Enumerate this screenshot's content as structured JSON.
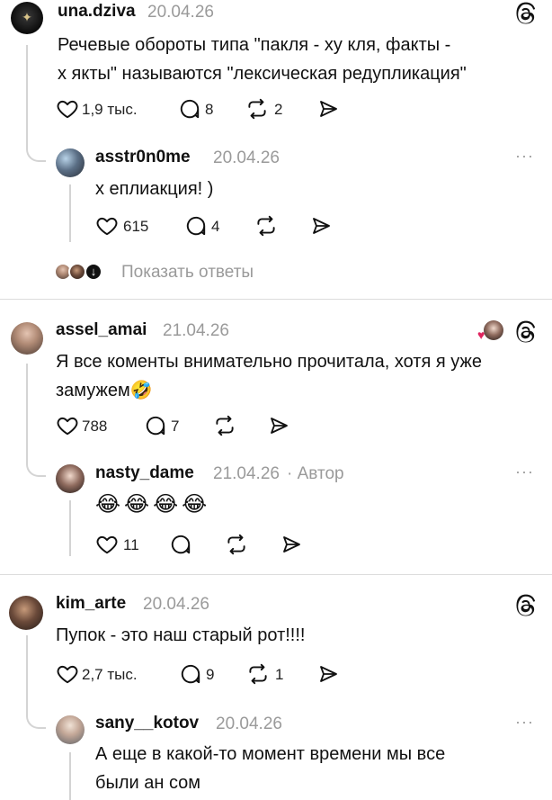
{
  "threads": [
    {
      "username": "una.dziva",
      "date": "20.04.26",
      "text_lines": [
        "Речевые обороты типа \"пакля - ху  кля, факты -",
        "х  якты\" называются \"лексическая редупликация\""
      ],
      "likes": "1,9 тыс.",
      "comments": "8",
      "reposts": "2",
      "replies": [
        {
          "username": "asstr0n0me",
          "date": "20.04.26",
          "text": "х  еплиакция! )",
          "likes": "615",
          "comments": "4"
        }
      ],
      "show_replies_label": "Показать ответы"
    },
    {
      "username": "assel_amai",
      "date": "21.04.26",
      "text_lines": [
        "Я все коменты внимательно прочитала, хотя я уже",
        "замужем🤣"
      ],
      "likes": "788",
      "comments": "7",
      "replies": [
        {
          "username": "nasty_dame",
          "date": "21.04.26",
          "author_tag": "· Автор",
          "text": "😂😂😂😂",
          "likes": "11"
        }
      ]
    },
    {
      "username": "kim_arte",
      "date": "20.04.26",
      "text_lines": [
        "Пупок - это наш старый рот!!!!"
      ],
      "likes": "2,7 тыс.",
      "comments": "9",
      "reposts": "1",
      "replies": [
        {
          "username": "sany__kotov",
          "date": "20.04.26",
          "text_lines": [
            "А еще в какой-то момент времени мы все",
            "были ан  сом"
          ]
        }
      ]
    }
  ],
  "more_label": "···",
  "icons": [
    "threads-icon",
    "heart-icon",
    "comment-icon",
    "repost-icon",
    "share-icon",
    "more-icon",
    "down-arrow-icon"
  ],
  "colors": {
    "text": "#111111",
    "muted": "#9a9a9a",
    "line": "#d4d4d4",
    "heart_red": "#e0245e"
  }
}
